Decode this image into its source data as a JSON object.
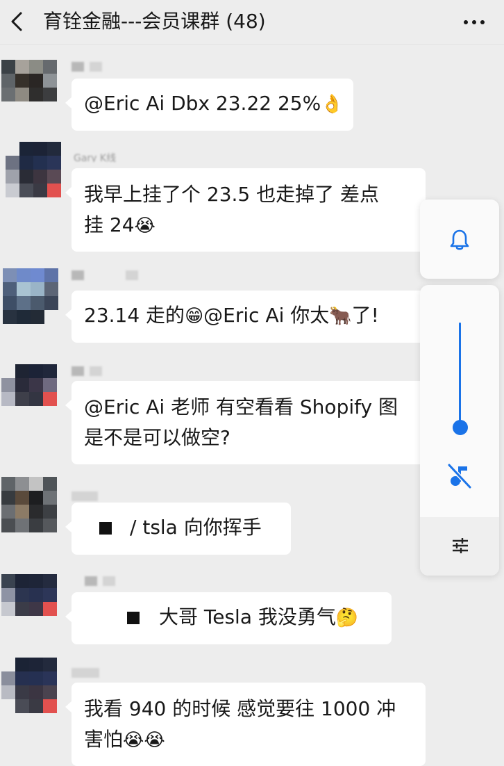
{
  "header": {
    "title": "育铨金融---会员课群 (48)"
  },
  "messages": [
    {
      "sender": "",
      "text": "@Eric Ai Dbx 23.22 25%",
      "emoji": "👌"
    },
    {
      "sender": "Gary K线",
      "line1": "我早上挂了个 23.5 也走掉了 差点",
      "line2": "挂 24",
      "emoji": "😭"
    },
    {
      "sender": "",
      "text_a": "23.14 走的",
      "emoji_a": "😁",
      "text_b": "@Eric Ai  你太",
      "emoji_b": "🐂",
      "text_c": "了!"
    },
    {
      "sender": "",
      "line1": "@Eric Ai  老师 有空看看 Shopify 图",
      "line2": "是不是可以做空?"
    },
    {
      "sender": "",
      "text": "/ tsla 向你挥手"
    },
    {
      "sender": "",
      "text": "大哥 Tesla 我没勇气",
      "emoji": "🤔"
    },
    {
      "sender": "",
      "line1": "我看 940 的时候 感觉要往 1000 冲",
      "line2": "害怕",
      "emoji": "😭😭"
    }
  ],
  "colors": {
    "accent": "#1a73e8",
    "bubble": "#ffffff",
    "background": "#ededed"
  },
  "icons": [
    "back-icon",
    "more-icon",
    "bell-icon",
    "mute-icon",
    "tune-icon"
  ],
  "volume": {
    "level": 0.0
  }
}
